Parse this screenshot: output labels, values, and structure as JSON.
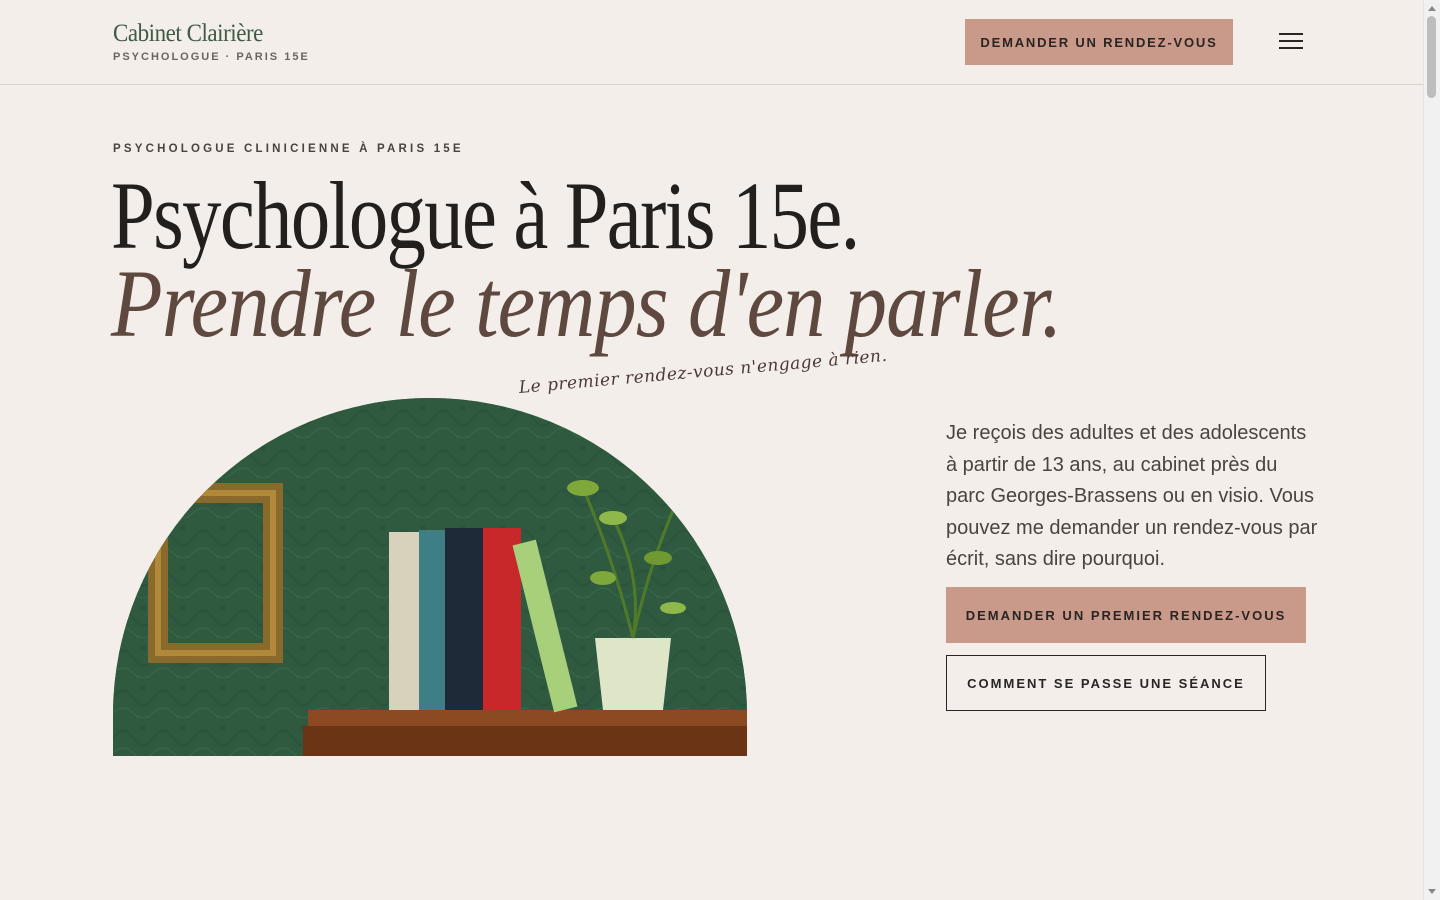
{
  "header": {
    "logo_name": "Cabinet Clairière",
    "logo_subtitle": "PSYCHOLOGUE · PARIS 15E",
    "cta_label": "DEMANDER UN RENDEZ-VOUS",
    "menu_icon": "hamburger-menu-icon"
  },
  "hero": {
    "eyebrow": "PSYCHOLOGUE CLINICIENNE À PARIS 15E",
    "title_line1": "Psychologue à Paris 15e.",
    "title_line2": "Prendre le temps d'en parler.",
    "handwritten_note": "Le premier rendez-vous n'engage à rien.",
    "intro": "Je reçois des adultes et des adolescents à partir de 13 ans, au cabinet près du parc Georges-Brassens ou en visio. Vous pouvez me demander un rendez-vous par écrit, sans dire pourquoi.",
    "primary_button": "DEMANDER UN PREMIER RENDEZ-VOUS",
    "secondary_button": "COMMENT SE PASSE UNE SÉANCE"
  },
  "colors": {
    "background": "#f3eee9",
    "accent": "#c99a8a",
    "logo_green": "#3f5a45",
    "title_brown": "#5e4840"
  }
}
